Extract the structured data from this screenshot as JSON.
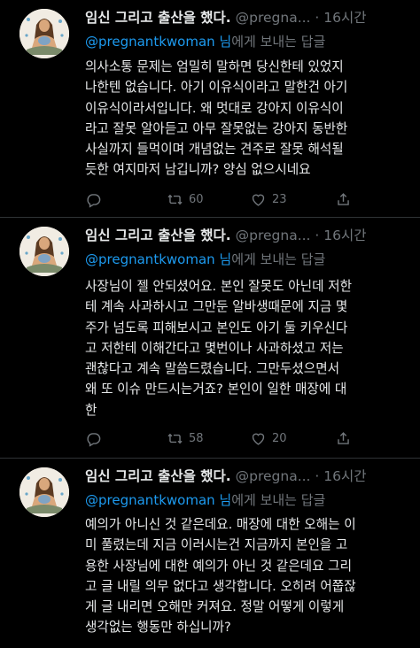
{
  "tweets": [
    {
      "display_name": "임신 그리고 출산을 했다.",
      "handle_time": "@pregna... · 16시간",
      "reply_user": "@pregnantkwoman 님",
      "reply_suffix": "에게 보내는 답글",
      "text": "의사소통 문제는 엄밀히 말하면 당신한테 있었지\n나한텐 없습니다. 아기 이유식이라고 말한건 아기\n이유식이라서입니다. 왜 멋대로 강아지 이유식이\n라고 잘못 알아듣고 아무 잘못없는 강아지 동반한\n사실까지 들먹이며 개념없는 견주로 잘못 해석될\n듯한 여지마저 남깁니까? 양심 없으시네요",
      "retweets": "60",
      "likes": "23"
    },
    {
      "display_name": "임신 그리고 출산을 했다.",
      "handle_time": "@pregna... · 16시간",
      "reply_user": "@pregnantkwoman 님",
      "reply_suffix": "에게 보내는 답글",
      "text": "사장님이 젤 안되셨어요. 본인 잘못도 아닌데 저한\n테 계속 사과하시고 그만둔 알바생때문에 지금 몇\n주가 넘도록 피해보시고 본인도 아기 둘 키우신다\n고 저한테 이해간다고 몇번이나 사과하셨고 저는\n괜찮다고 계속 말씀드렸습니다. 그만두셨으면서\n왜 또 이슈 만드시는거죠? 본인이 일한 매장에 대\n한",
      "retweets": "58",
      "likes": "20"
    },
    {
      "display_name": "임신 그리고 출산을 했다.",
      "handle_time": "@pregna... · 16시간",
      "reply_user": "@pregnantkwoman 님",
      "reply_suffix": "에게 보내는 답글",
      "text": "예의가 아니신 것 같은데요. 매장에 대한 오해는 이\n미 풀렸는데 지금 이러시는건 지금까지 본인을 고\n용한 사장님에 대한 예의가 아닌 것 같은데요 그리\n고 글 내릴 의무 없다고 생각합니다. 오히려 어쭙잖\n게 글 내리면 오해만 커져요. 정말 어떻게 이렇게\n생각없는 행동만 하십니까?",
      "retweets": "",
      "likes": ""
    }
  ],
  "colors": {
    "background": "#000000",
    "text": "#e7e9ea",
    "muted": "#71767b",
    "link": "#1d9bf0",
    "divider": "#2f3336"
  },
  "icons": [
    "avatar-illustration",
    "reply-icon",
    "retweet-icon",
    "like-icon",
    "share-icon"
  ]
}
